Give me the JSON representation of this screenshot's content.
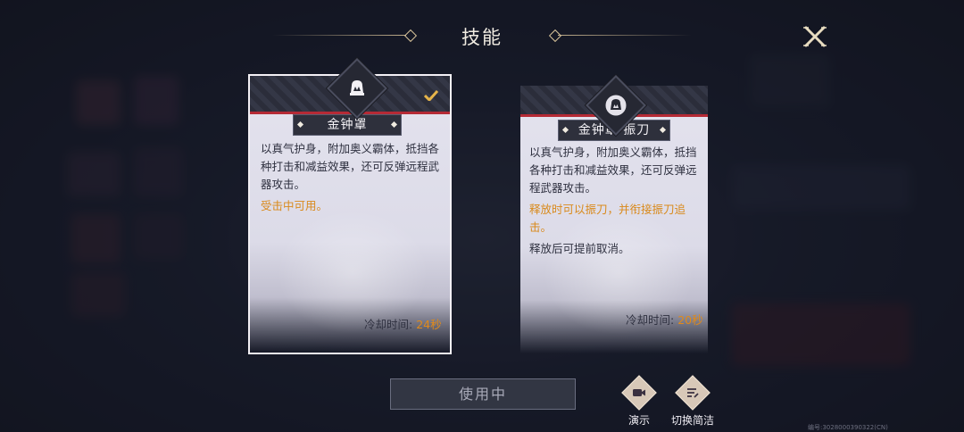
{
  "header": {
    "title": "技能"
  },
  "cards": [
    {
      "name": "金钟罩",
      "selected": true,
      "description": "以真气护身，附加奥义霸体，抵挡各种打击和减益效果，还可反弹远程武器攻击。",
      "highlight": "受击中可用。",
      "note": "",
      "cooldown_label": "冷却时间:",
      "cooldown_value": "24秒",
      "icon": "bell-icon"
    },
    {
      "name": "金钟罩·振刀",
      "selected": false,
      "description": "以真气护身，附加奥义霸体，抵挡各种打击和减益效果，还可反弹远程武器攻击。",
      "highlight": "释放时可以振刀，并衔接振刀追击。",
      "note": "释放后可提前取消。",
      "cooldown_label": "冷却时间:",
      "cooldown_value": "20秒",
      "icon": "bell-icon"
    }
  ],
  "footer": {
    "use_button": "使用中",
    "demo_label": "演示",
    "switch_label": "切换简洁",
    "build_id": "编号:3028000390322(CN)"
  },
  "colors": {
    "accent_red": "#b52a35",
    "highlight_orange": "#d98a1c",
    "plate_dark": "#2e303c"
  }
}
